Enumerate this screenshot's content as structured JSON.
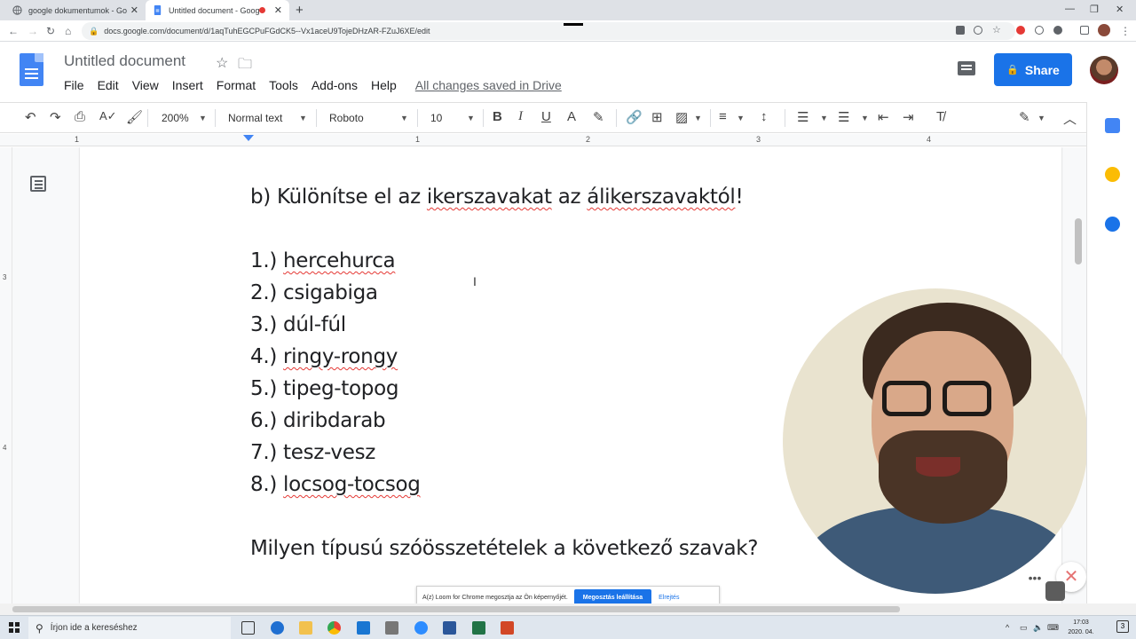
{
  "browser": {
    "tabs": [
      {
        "title": "google dokumentumok - Google",
        "active": false
      },
      {
        "title": "Untitled document - Google",
        "active": true,
        "recording": true
      }
    ],
    "url": "docs.google.com/document/d/1aqTuhEGCPuFGdCK5--Vx1aceU9TojeDHzAR-FZuJ6XE/edit"
  },
  "docs": {
    "title": "Untitled document",
    "menu": [
      "File",
      "Edit",
      "View",
      "Insert",
      "Format",
      "Tools",
      "Add-ons",
      "Help"
    ],
    "save_status": "All changes saved in Drive",
    "share_label": "Share",
    "toolbar": {
      "zoom": "200%",
      "style": "Normal text",
      "font": "Roboto",
      "size": "10"
    },
    "ruler_numbers": [
      "1",
      "1",
      "2",
      "3",
      "4"
    ],
    "vruler_numbers": [
      "3",
      "4"
    ]
  },
  "content": {
    "heading_parts": [
      {
        "text": "b) Különítse el az ",
        "squiggle": false
      },
      {
        "text": "ikerszavakat",
        "squiggle": true
      },
      {
        "text": " az ",
        "squiggle": false
      },
      {
        "text": "álikerszavaktól",
        "squiggle": true
      },
      {
        "text": "!",
        "squiggle": false
      }
    ],
    "items": [
      {
        "num": "1.) ",
        "word": "hercehurca",
        "squiggle": true
      },
      {
        "num": "2.) ",
        "word": "csigabiga",
        "squiggle": false
      },
      {
        "num": "3.) ",
        "word": "dúl-fúl",
        "squiggle": false
      },
      {
        "num": "4.) ",
        "word": "ringy-rongy",
        "squiggle": true
      },
      {
        "num": "5.) ",
        "word": "tipeg-topog",
        "squiggle": false
      },
      {
        "num": "6.) ",
        "word": "diribdarab",
        "squiggle": false
      },
      {
        "num": "7.) ",
        "word": "tesz-vesz",
        "squiggle": false
      },
      {
        "num": "8.) ",
        "word": "locsog-tocsog",
        "squiggle": true
      }
    ],
    "question": "Milyen típusú szóösszetételek a következő szavak?"
  },
  "loom": {
    "share_message": "A(z) Loom for Chrome megosztja az Ön képernyőjét.",
    "stop_label": "Megosztás leállítása",
    "hide_label": "Elrejtés"
  },
  "taskbar": {
    "search_placeholder": "Írjon ide a kereséshez",
    "time": "17:03",
    "date": "2020. 04. 01.",
    "notifications": "3"
  },
  "colors": {
    "accent": "#1a73e8",
    "spellcheck": "#e53935",
    "docs_blue": "#4285f4"
  }
}
